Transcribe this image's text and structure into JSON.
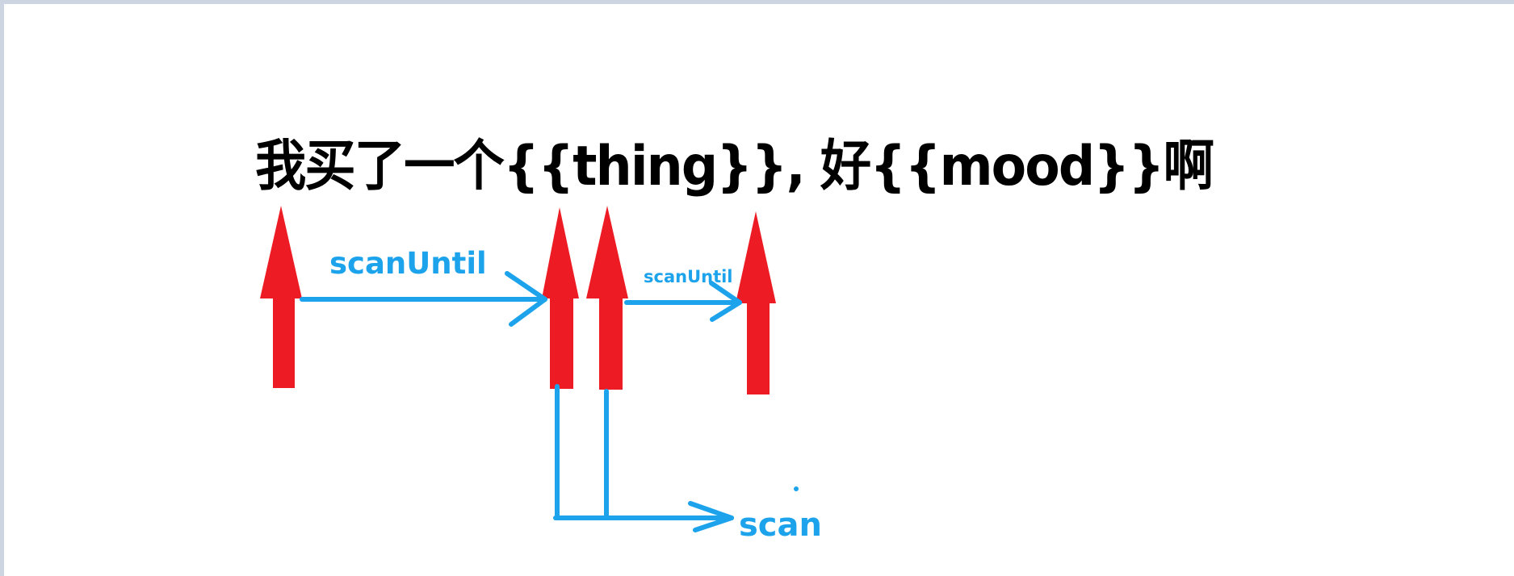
{
  "sentence": "我买了一个{{thing}}, 好{{mood}}啊",
  "labels": {
    "scan_until_first": "scanUntil",
    "scan_until_second": "scanUntil",
    "scan": "scan"
  },
  "colors": {
    "pointer_arrow": "#ed1c24",
    "flow_arrow": "#1ca3ec",
    "text": "#000000",
    "background": "#ffffff"
  }
}
